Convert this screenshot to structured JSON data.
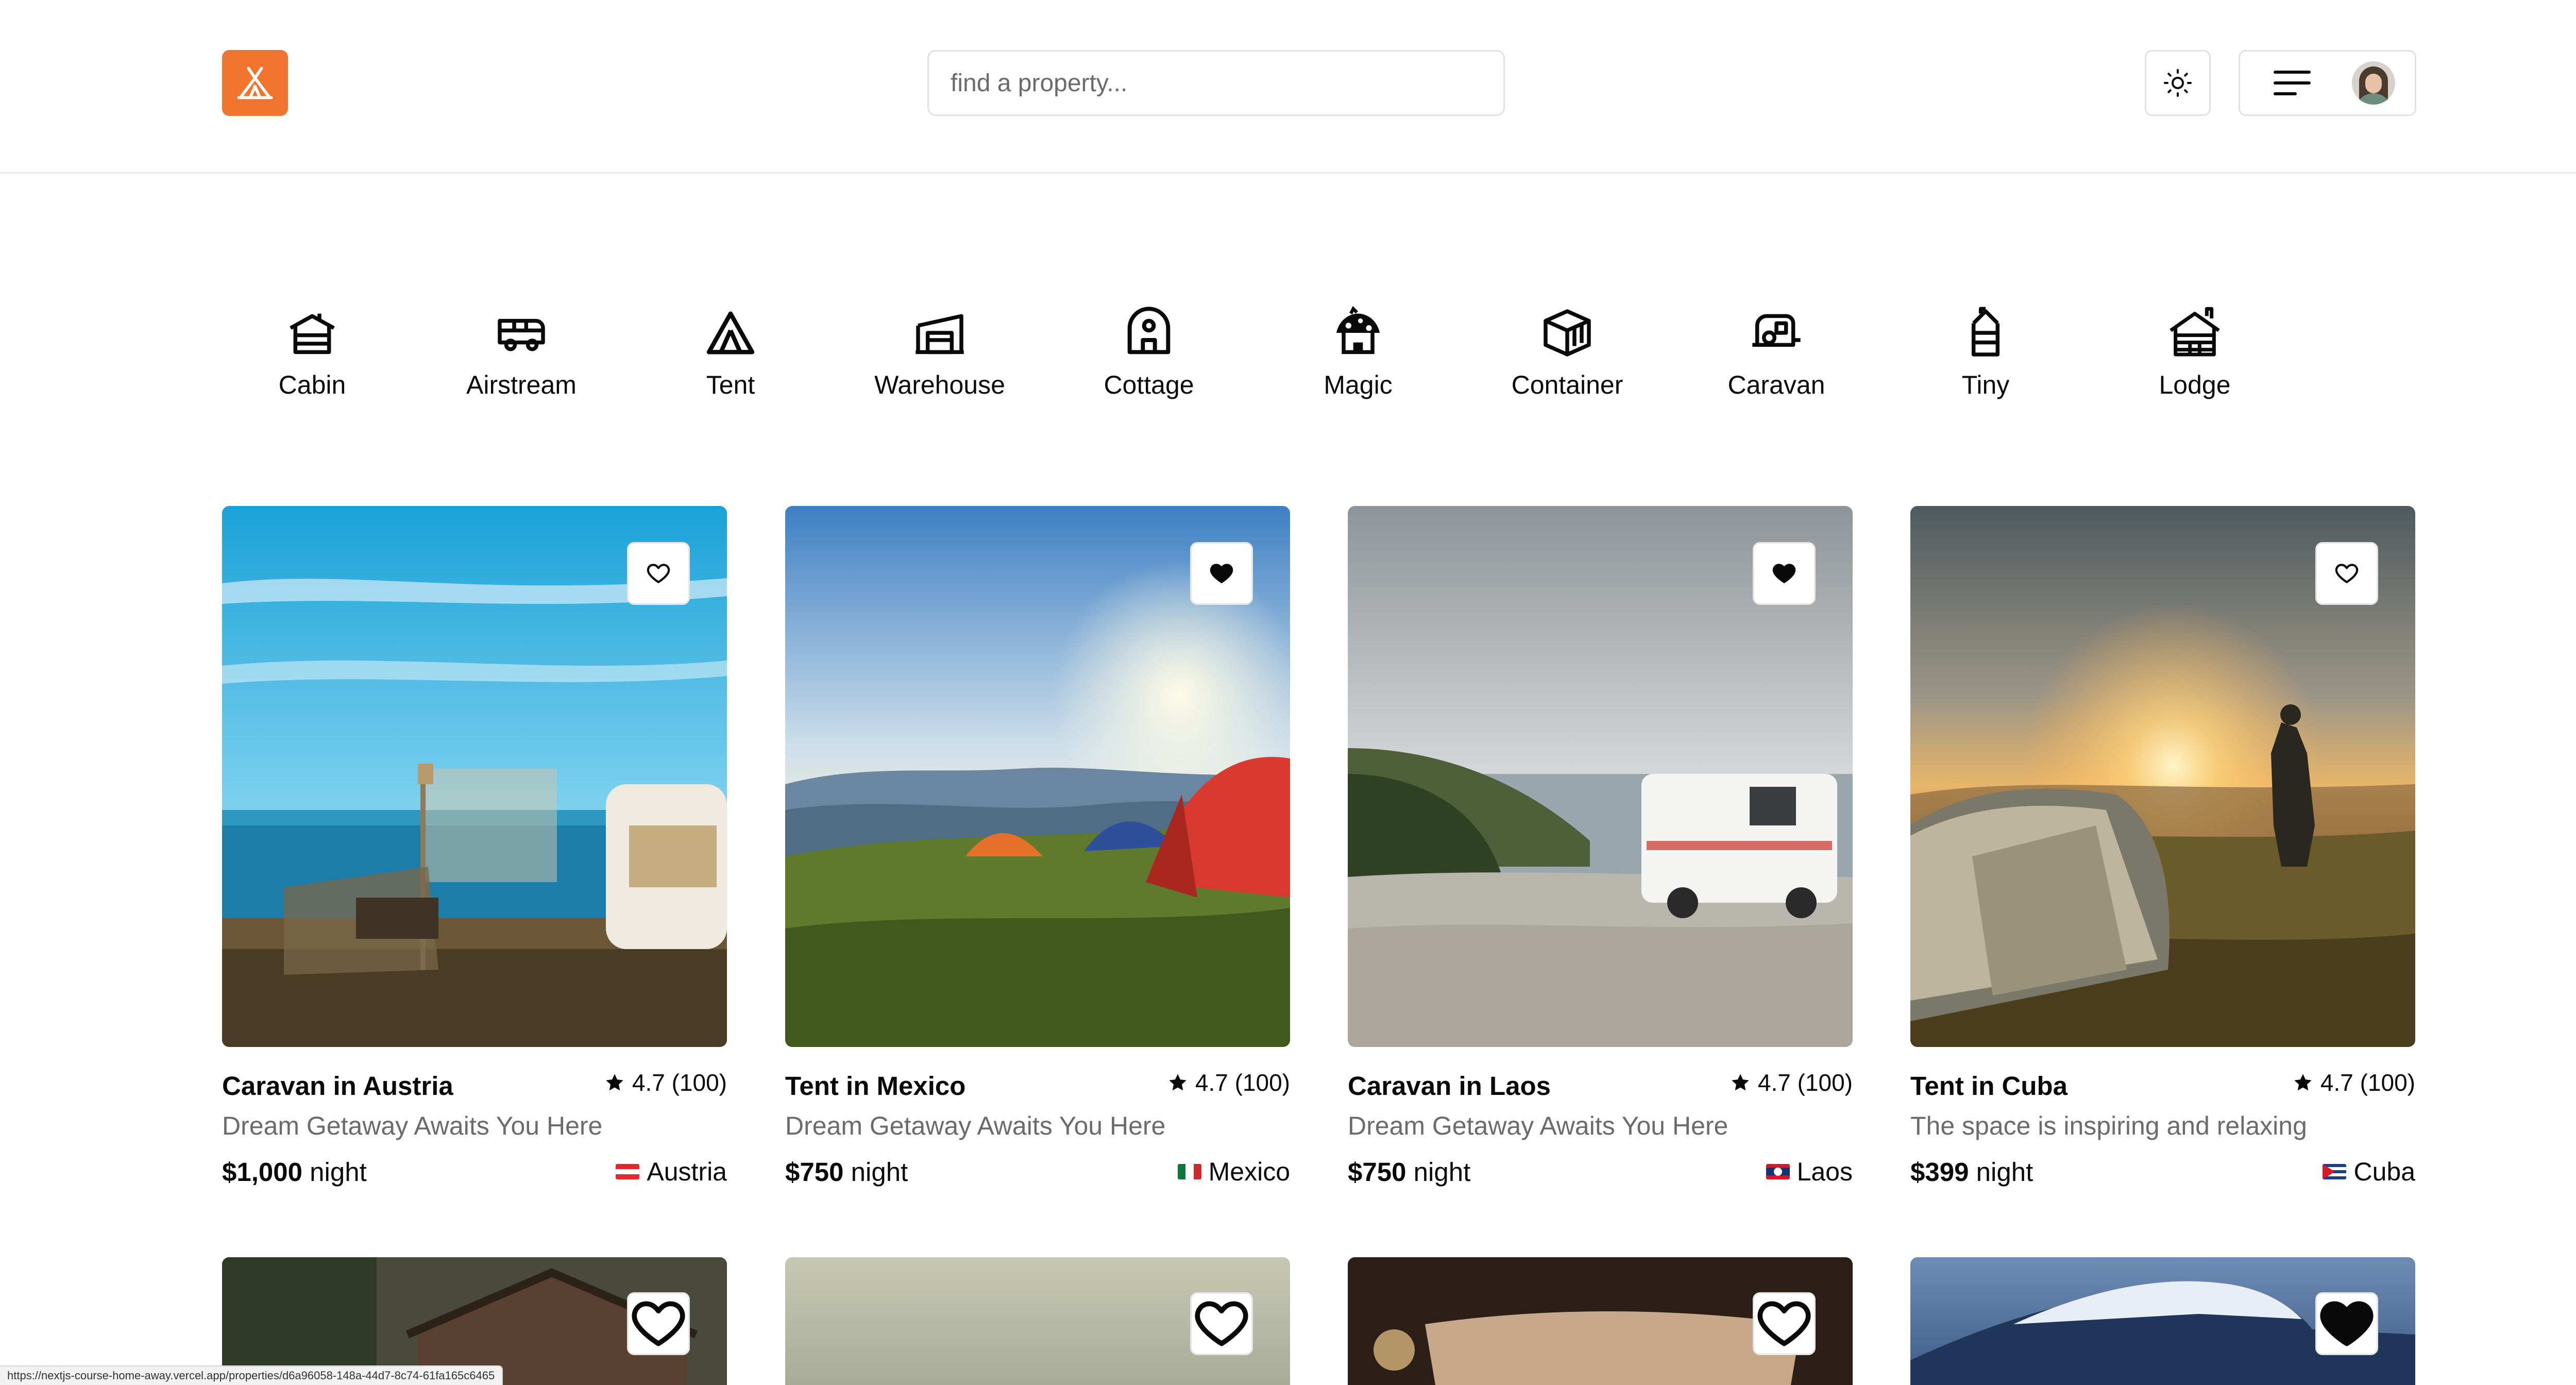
{
  "header": {
    "logo_icon": "tent-logo-icon",
    "logo_color": "#f0742e",
    "search_placeholder": "find a property...",
    "theme_toggle_icon": "sun-icon",
    "menu_icon": "hamburger-icon",
    "avatar_icon": "user-avatar"
  },
  "categories": [
    {
      "label": "Cabin",
      "icon": "cabin-icon"
    },
    {
      "label": "Airstream",
      "icon": "airstream-icon"
    },
    {
      "label": "Tent",
      "icon": "tent-icon"
    },
    {
      "label": "Warehouse",
      "icon": "warehouse-icon"
    },
    {
      "label": "Cottage",
      "icon": "cottage-icon"
    },
    {
      "label": "Magic",
      "icon": "magic-icon"
    },
    {
      "label": "Container",
      "icon": "container-icon"
    },
    {
      "label": "Caravan",
      "icon": "caravan-icon"
    },
    {
      "label": "Tiny",
      "icon": "tiny-house-icon"
    },
    {
      "label": "Lodge",
      "icon": "lodge-icon"
    }
  ],
  "properties": [
    {
      "title": "Caravan in Austria",
      "rating": "4.7 (100)",
      "tagline": "Dream Getaway Awaits You Here",
      "price": "$1,000",
      "price_unit": "night",
      "country": "Austria",
      "favorited": false
    },
    {
      "title": "Tent in Mexico",
      "rating": "4.7 (100)",
      "tagline": "Dream Getaway Awaits You Here",
      "price": "$750",
      "price_unit": "night",
      "country": "Mexico",
      "favorited": true
    },
    {
      "title": "Caravan in Laos",
      "rating": "4.7 (100)",
      "tagline": "Dream Getaway Awaits You Here",
      "price": "$750",
      "price_unit": "night",
      "country": "Laos",
      "favorited": true
    },
    {
      "title": "Tent in Cuba",
      "rating": "4.7 (100)",
      "tagline": "The space is inspiring and relaxing",
      "price": "$399",
      "price_unit": "night",
      "country": "Cuba",
      "favorited": false
    }
  ],
  "next_row_favorited": [
    false,
    false,
    false,
    true
  ],
  "status_url": "https://nextjs-course-home-away.vercel.app/properties/d6a96058-148a-44d7-8c74-61fa165c6465"
}
